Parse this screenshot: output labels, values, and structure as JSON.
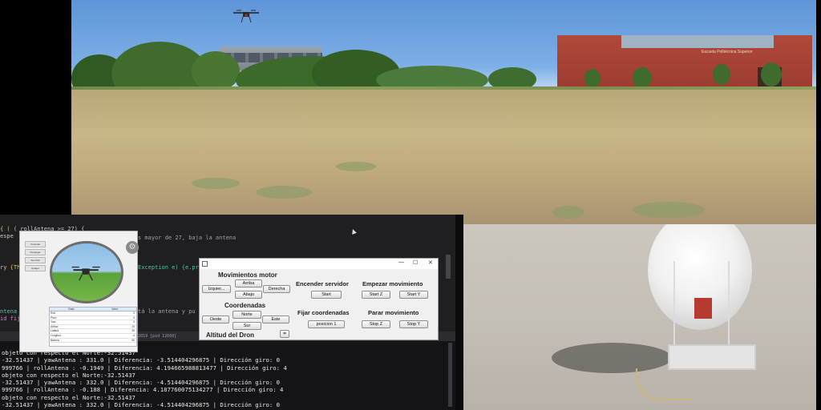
{
  "editor": {
    "lines": [
      {
        "pre": "  ",
        "kw": "if",
        "code": " ( rollAntena >= 27) {"
      },
      {
        "pre": "   espe",
        "kw": "",
        "code": ""
      },
      {
        "pre": "",
        "kw": "",
        "code": "s mayor de 27, baja la antena"
      },
      {
        "pre": "ry {Th",
        "kw": "",
        "code": ""
      },
      {
        "pre": "",
        "kw": "",
        "code": "Exception e) {e.pr"
      },
      {
        "pre": "ntena",
        "kw": "",
        "code": ""
      },
      {
        "pre": "id fij",
        "kw": "",
        "code": ""
      },
      {
        "pre": "",
        "kw": "",
        "code": "tá la antena y pu"
      }
    ]
  },
  "console": {
    "tab_label": "07/05/2019 [pid 12660]",
    "lines": [
      "objeto con respecto el Norte:-32.51437",
      " -32.51437 | yawAntena : 331.0 | Diferencia: -3.514404296875 | Dirección giro: 0",
      "999766 | rollAntena : -0.1949 | Diferencia: 4.194665988813477 | Dirección giro: 4",
      "objeto con respecto el Norte:-32.51437",
      " -32.51437 | yawAntena : 332.0 | Diferencia: -4.514404296875 | Dirección giro: 0",
      "999766 | rollAntena : -0.188 | Diferencia: 4.187760075134277 | Dirección giro: 4",
      "objeto con respecto el Norte:-32.51437",
      " -32.51437 | yawAntena : 332.0 | Diferencia: -4.514404296875 | Dirección giro: 0"
    ]
  },
  "drone_window": {
    "buttons": [
      "Conectar",
      "Despegar",
      "Aterrizar",
      "Apagar"
    ],
    "table_headers": [
      "Dato",
      "Valor"
    ],
    "table_rows": [
      [
        "Roll",
        "0"
      ],
      [
        "Pitch",
        "0"
      ],
      [
        "Yaw",
        "0"
      ],
      [
        "Altitud",
        "20"
      ],
      [
        "Latitud",
        "39"
      ],
      [
        "Longitud",
        "-4"
      ],
      [
        "Batería",
        "90"
      ]
    ]
  },
  "control_window": {
    "motor_title": "Movimientos motor",
    "izquierda": "Izquier...",
    "arriba": "Arriba",
    "abajo": "Abajo",
    "derecha": "Derecha",
    "coords_title": "Coordenadas",
    "norte": "Norte",
    "oeste": "Oeste",
    "sur": "Sur",
    "este": "Este",
    "altitude_title": "Altitud del Dron",
    "server_title": "Encender servidor",
    "start": "Start",
    "fix_title": "Fijar coordenadas",
    "posicion": "posicion 1",
    "begin_title": "Empezar movimiento",
    "start_z": "Start Z",
    "start_y": "Start Y",
    "stop_title": "Parar movimiento",
    "stop_z": "Stop Z",
    "stop_y": "Stop Y",
    "win_controls": [
      "—",
      "☐",
      "✕"
    ]
  },
  "field_video": {
    "building_sign": "Escuela Politécnica Superior"
  },
  "colors": {
    "sky": "#6fa4e0",
    "editor_bg": "#1f1f22",
    "console_bg": "#141416",
    "building_brick": "#a3463a"
  }
}
